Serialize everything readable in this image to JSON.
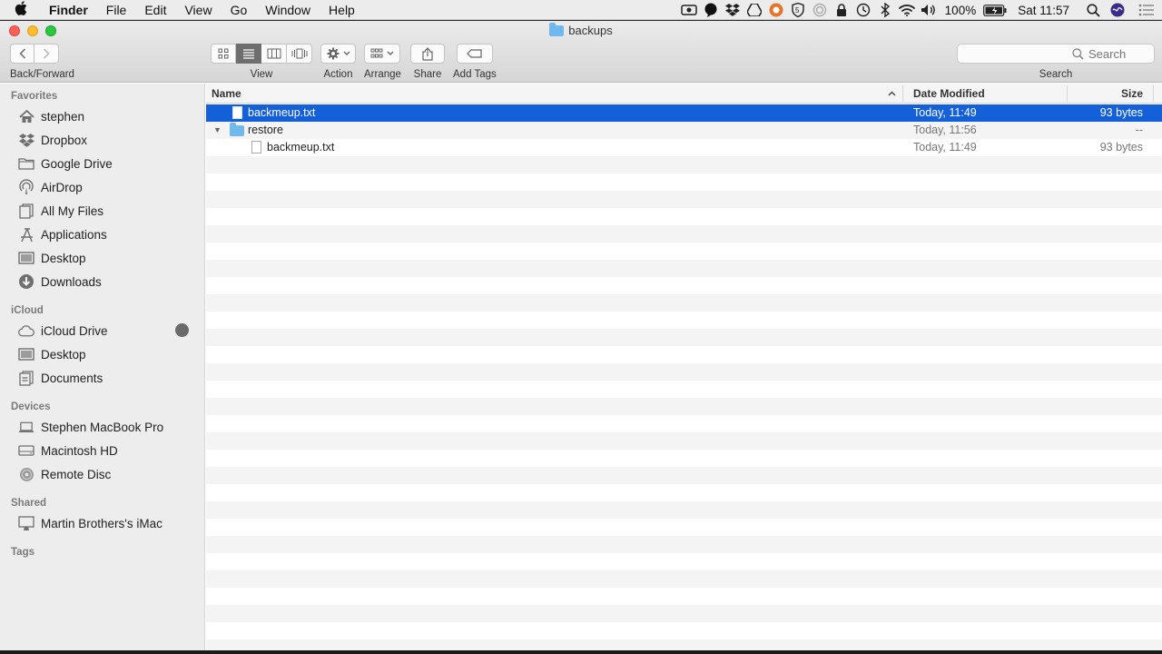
{
  "menubar": {
    "apple_icon": "apple-icon",
    "app_name": "Finder",
    "menus": [
      "File",
      "Edit",
      "View",
      "Go",
      "Window",
      "Help"
    ],
    "battery": "100%",
    "clock": "Sat 11:57"
  },
  "window": {
    "title": "backups"
  },
  "toolbar": {
    "back_forward_label": "Back/Forward",
    "view_label": "View",
    "action_label": "Action",
    "arrange_label": "Arrange",
    "share_label": "Share",
    "add_tags_label": "Add Tags",
    "search_placeholder": "Search",
    "search_label": "Search"
  },
  "sidebar": {
    "favorites_header": "Favorites",
    "favorites": [
      {
        "label": "stephen",
        "icon": "home-icon"
      },
      {
        "label": "Dropbox",
        "icon": "dropbox-icon"
      },
      {
        "label": "Google Drive",
        "icon": "folder-icon"
      },
      {
        "label": "AirDrop",
        "icon": "airdrop-icon"
      },
      {
        "label": "All My Files",
        "icon": "all-files-icon"
      },
      {
        "label": "Applications",
        "icon": "applications-icon"
      },
      {
        "label": "Desktop",
        "icon": "desktop-icon"
      },
      {
        "label": "Downloads",
        "icon": "downloads-icon"
      }
    ],
    "icloud_header": "iCloud",
    "icloud": [
      {
        "label": "iCloud Drive",
        "icon": "cloud-icon"
      },
      {
        "label": "Desktop",
        "icon": "desktop-icon"
      },
      {
        "label": "Documents",
        "icon": "documents-icon"
      }
    ],
    "devices_header": "Devices",
    "devices": [
      {
        "label": "Stephen MacBook Pro",
        "icon": "laptop-icon"
      },
      {
        "label": "Macintosh HD",
        "icon": "hard-drive-icon"
      },
      {
        "label": "Remote Disc",
        "icon": "disc-icon"
      }
    ],
    "shared_header": "Shared",
    "shared": [
      {
        "label": "Martin Brothers's iMac",
        "icon": "imac-icon"
      }
    ],
    "tags_header": "Tags"
  },
  "list": {
    "columns": {
      "name": "Name",
      "date": "Date Modified",
      "size": "Size"
    },
    "rows": [
      {
        "name": "backmeup.txt",
        "date": "Today, 11:49",
        "size": "93 bytes",
        "kind": "file",
        "selected": true
      },
      {
        "name": "restore",
        "date": "Today, 11:56",
        "size": "--",
        "kind": "folder",
        "expanded": true
      },
      {
        "name": "backmeup.txt",
        "date": "Today, 11:49",
        "size": "93 bytes",
        "kind": "file"
      }
    ]
  },
  "colors": {
    "selection": "#1360d8",
    "folder": "#6fb9ef"
  }
}
